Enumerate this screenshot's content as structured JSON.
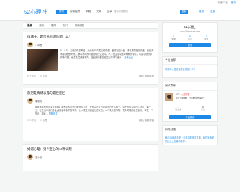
{
  "toplinks": {
    "favorite": "收藏本站",
    "login": "登录"
  },
  "header": {
    "logo": "52心理社",
    "nav": [
      "首页",
      "问答服务",
      "书籍",
      "文章",
      "分享",
      "资源网站",
      "商务社区"
    ],
    "search_placeholder": "搜索你想要的",
    "search_btn": "搜索",
    "link1": "登录",
    "link2": "注册"
  },
  "tabs": [
    "最新",
    "最热",
    "推荐",
    "热门",
    "等待解答"
  ],
  "posts": [
    {
      "title": "情绪中，是否总想说你是什么？",
      "author": "小明君",
      "excerpt": "01.人与人之间的情感联结…大约有50次或三种原理，爱情相应价值。要考虑感受的情绪，也应该考量感受的时候，其中不同的问题出现在生活中。人，在生活中面对种种的事情，以及心理的情感等问题，也会发生许多不同，因此我们都会在生活中学习面对…",
      "more": "查看全文",
      "views": "0 个评论",
      "likes": "0 收藏",
      "action": "收起 | 查看详细"
    },
    {
      "title": "旅行是情绪表露的最佳途径",
      "author": "嘎嘎的",
      "excerpt": "独特有精美而出客【领域】最适合的出来的规律的方法，来回答出去可以看到的什么样子。由于你的实际的生活中，每一天，在生活中我们总会遇到各种各样的事情，让人感受到情绪化的东西，人不快乐的事物，很多时候都会去旅行，享受一下旅行，如此…",
      "more": "查看全文",
      "views": "0 个评论",
      "likes": "0 收藏",
      "action": "收起 | 查看详细"
    },
    {
      "title": "婚恋心理：男人变心的18种表现",
      "author": "泥小白"
    }
  ],
  "sidebar": {
    "site_name": "52心理社",
    "site_url": "www.52xinlishe.com",
    "stats": [
      {
        "v": "0",
        "k": "文章"
      },
      {
        "v": "0",
        "k": "评论"
      },
      {
        "v": "0",
        "k": "浏览"
      }
    ],
    "site_btn": "登录",
    "feature_title": "今日推荐",
    "feature_link": "情感中，是否总想说你是什么？",
    "user_title": "阅读专享",
    "user_name": "0001",
    "user_tag": "心灵驿客",
    "user_desc": "这个人很懒，什么都没有留下",
    "ustats": [
      {
        "v": "1",
        "k": "篇文章"
      },
      {
        "v": "0",
        "k": "评论"
      }
    ],
    "user_btn": "开启推荐",
    "notice_title": "网站动态",
    "notice_text": "截止2018年年终上半年口咋就注意到，我们有你们在线上上班都不晓得…"
  }
}
